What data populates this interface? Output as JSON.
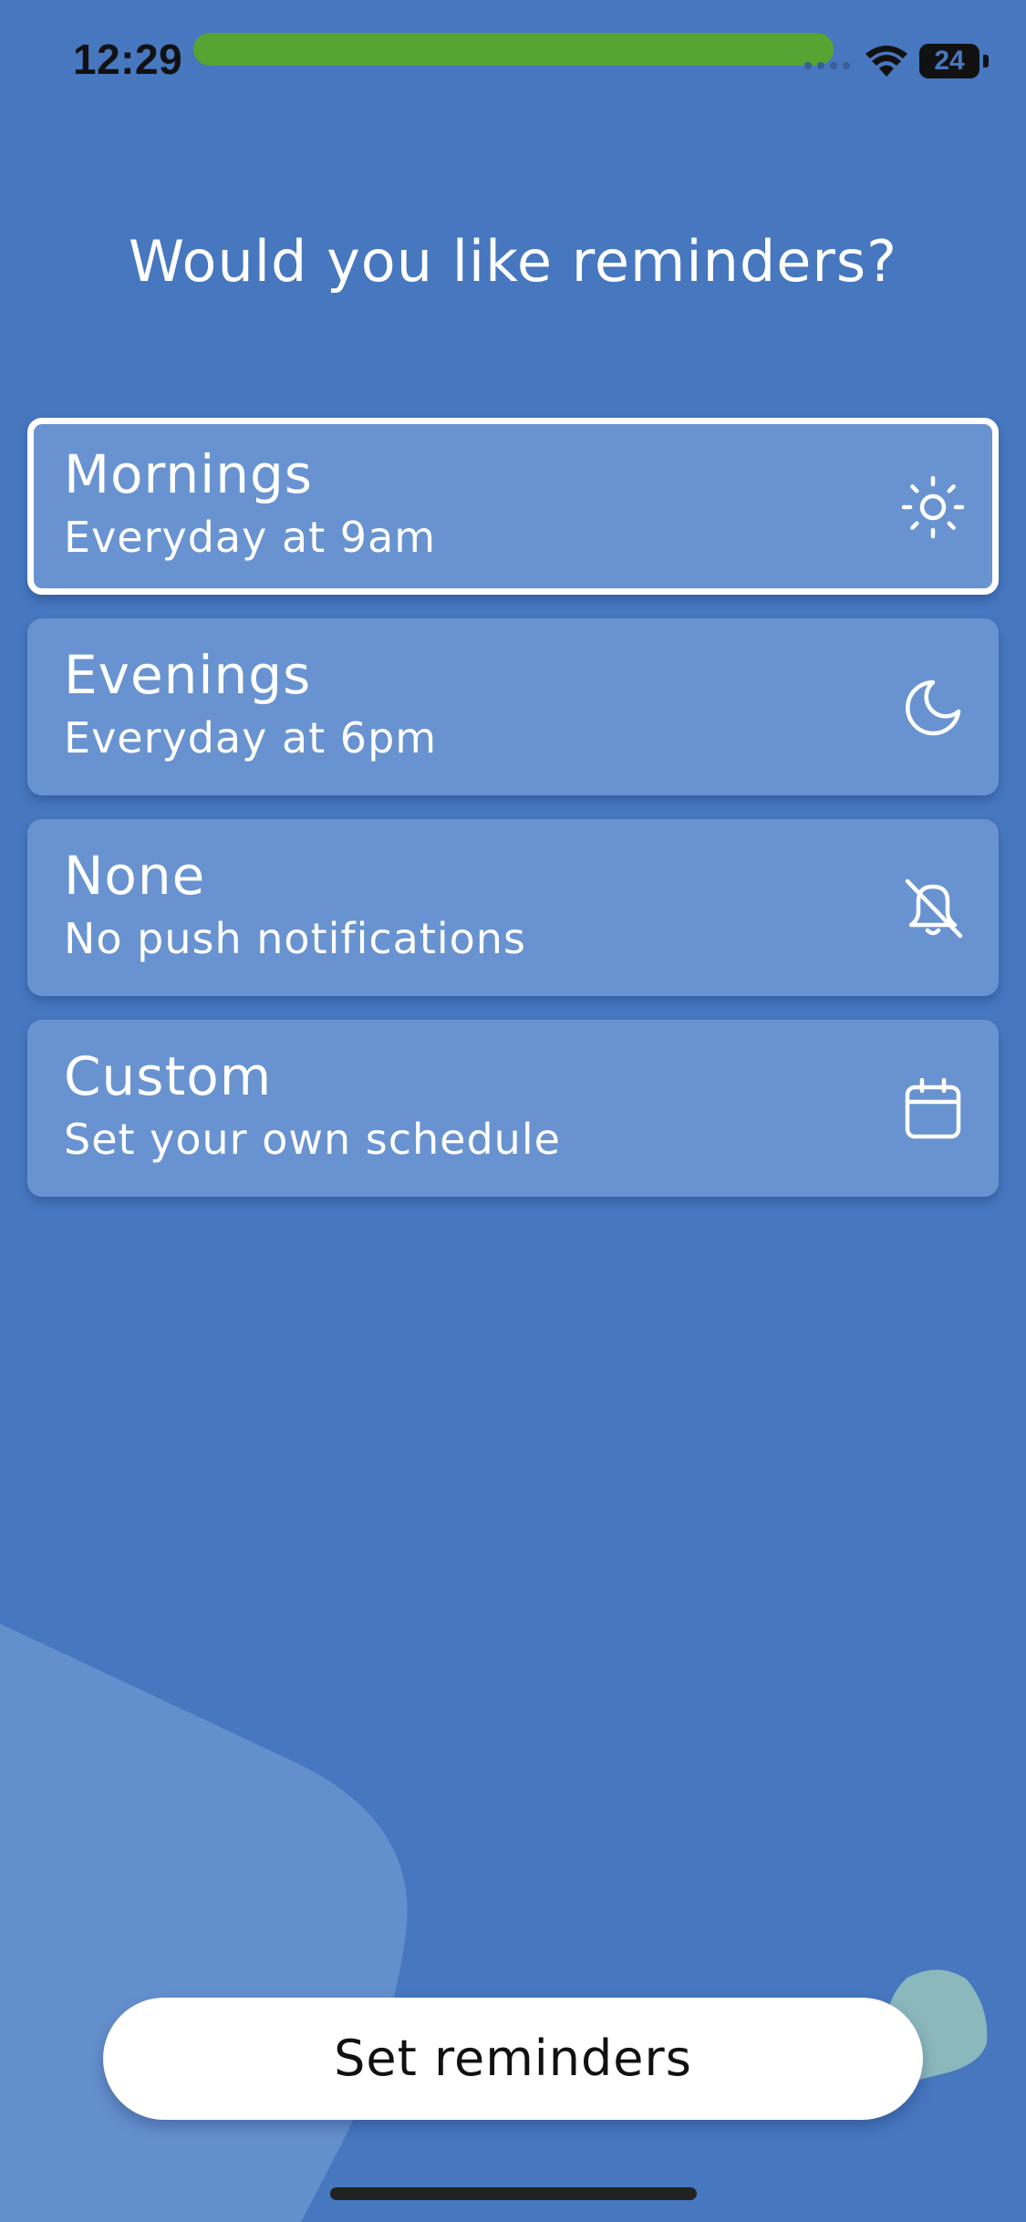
{
  "status_bar": {
    "time": "12:29",
    "battery_level": "24"
  },
  "title": "Would you like reminders?",
  "options": [
    {
      "title": "Mornings",
      "subtitle": "Everyday at 9am",
      "icon": "sun-icon",
      "selected": true
    },
    {
      "title": "Evenings",
      "subtitle": "Everyday at 6pm",
      "icon": "moon-icon",
      "selected": false
    },
    {
      "title": "None",
      "subtitle": "No push notifications",
      "icon": "bell-off-icon",
      "selected": false
    },
    {
      "title": "Custom",
      "subtitle": "Set your own schedule",
      "icon": "calendar-icon",
      "selected": false
    }
  ],
  "button": {
    "label": "Set reminders"
  },
  "colors": {
    "background": "#4677BF",
    "card": "#6893D0",
    "call_pill": "#55A532",
    "accent_blob": "#8BB8BC",
    "button": "#FFFFFF"
  }
}
